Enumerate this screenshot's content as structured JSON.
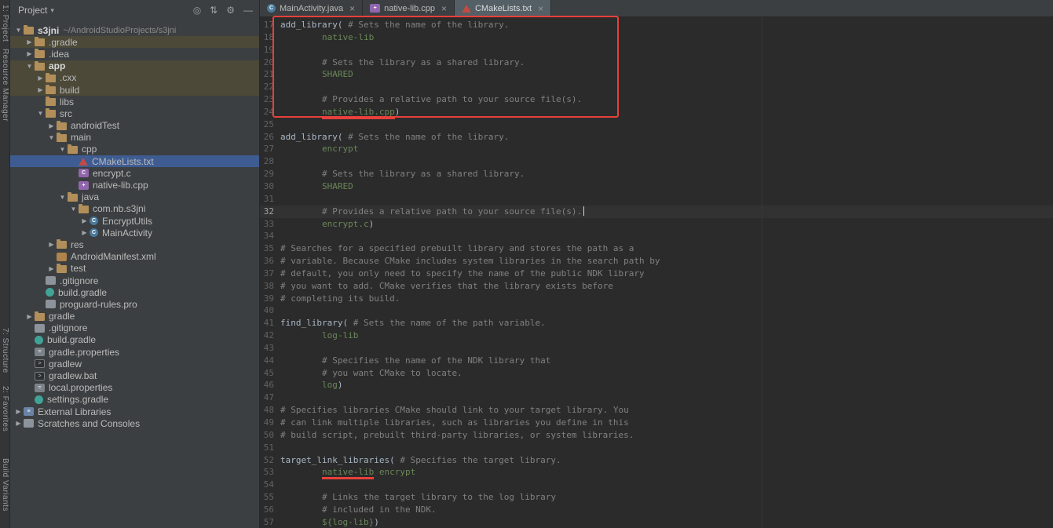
{
  "colors": {
    "selection_blue": "#3e5c92",
    "excluded_olive": "#4c4939",
    "annotation_red": "#e8403a",
    "code_plain": "#a9b7c6",
    "code_comment": "#808080",
    "code_argument": "#6a8759"
  },
  "left_strip": {
    "items": [
      {
        "label": "1: Project"
      },
      {
        "label": "Resource Manager"
      },
      {
        "label": "7: Structure"
      },
      {
        "label": "2: Favorites"
      },
      {
        "label": "Build Variants"
      }
    ]
  },
  "project_panel": {
    "header": {
      "title": "Project",
      "caret": "▾",
      "icons": [
        {
          "name": "locate-file-icon",
          "glyph": "◎"
        },
        {
          "name": "collapse-all-icon",
          "glyph": "⇅"
        },
        {
          "name": "settings-gear-icon",
          "glyph": "⚙"
        },
        {
          "name": "hide-panel-icon",
          "glyph": "―"
        }
      ]
    },
    "tree": [
      {
        "l": "s3jni",
        "s": "~/AndroidStudioProjects/s3jni",
        "v": 0,
        "i": "folder",
        "c": "d",
        "b": 1
      },
      {
        "l": ".gradle",
        "v": 1,
        "i": "folder",
        "c": "r",
        "tint": 1
      },
      {
        "l": ".idea",
        "v": 1,
        "i": "folder",
        "c": "r"
      },
      {
        "l": "app",
        "v": 1,
        "i": "folder",
        "c": "d",
        "tint": 1,
        "b": 1
      },
      {
        "l": ".cxx",
        "v": 2,
        "i": "folder",
        "c": "r",
        "tint": 1
      },
      {
        "l": "build",
        "v": 2,
        "i": "folder",
        "c": "r",
        "tint": 1
      },
      {
        "l": "libs",
        "v": 2,
        "i": "folder"
      },
      {
        "l": "src",
        "v": 2,
        "i": "folder",
        "c": "d"
      },
      {
        "l": "androidTest",
        "v": 3,
        "i": "folder",
        "c": "r"
      },
      {
        "l": "main",
        "v": 3,
        "i": "folder",
        "c": "d"
      },
      {
        "l": "cpp",
        "v": 4,
        "i": "folder",
        "c": "d"
      },
      {
        "l": "CMakeLists.txt",
        "v": 5,
        "i": "cmake",
        "sel": 1
      },
      {
        "l": "encrypt.c",
        "v": 5,
        "i": "c-file"
      },
      {
        "l": "native-lib.cpp",
        "v": 5,
        "i": "cpp-file"
      },
      {
        "l": "java",
        "v": 4,
        "i": "folder",
        "c": "d"
      },
      {
        "l": "com.nb.s3jni",
        "v": 5,
        "i": "package",
        "c": "d"
      },
      {
        "l": "EncryptUtils",
        "v": 6,
        "i": "class",
        "c": "r"
      },
      {
        "l": "MainActivity",
        "v": 6,
        "i": "class",
        "c": "r"
      },
      {
        "l": "res",
        "v": 3,
        "i": "folder",
        "c": "r"
      },
      {
        "l": "AndroidManifest.xml",
        "v": 3,
        "i": "xml-file"
      },
      {
        "l": "test",
        "v": 3,
        "i": "folder",
        "c": "r"
      },
      {
        "l": ".gitignore",
        "v": 2,
        "i": "gitignore"
      },
      {
        "l": "build.gradle",
        "v": 2,
        "i": "gradle"
      },
      {
        "l": "proguard-rules.pro",
        "v": 2,
        "i": "proguard"
      },
      {
        "l": "gradle",
        "v": 1,
        "i": "folder",
        "c": "r"
      },
      {
        "l": ".gitignore",
        "v": 1,
        "i": "gitignore"
      },
      {
        "l": "build.gradle",
        "v": 1,
        "i": "gradle"
      },
      {
        "l": "gradle.properties",
        "v": 1,
        "i": "properties"
      },
      {
        "l": "gradlew",
        "v": 1,
        "i": "shell"
      },
      {
        "l": "gradlew.bat",
        "v": 1,
        "i": "shell"
      },
      {
        "l": "local.properties",
        "v": 1,
        "i": "properties"
      },
      {
        "l": "settings.gradle",
        "v": 1,
        "i": "gradle"
      },
      {
        "l": "External Libraries",
        "v": 0,
        "i": "libraries",
        "c": "r"
      },
      {
        "l": "Scratches and Consoles",
        "v": 0,
        "i": "scratches",
        "c": "r"
      }
    ]
  },
  "editor": {
    "close_glyph": "×",
    "tabs": [
      {
        "label": "MainActivity.java",
        "icon": "class",
        "active": false
      },
      {
        "label": "native-lib.cpp",
        "icon": "cpp-file",
        "active": false
      },
      {
        "label": "CMakeLists.txt",
        "icon": "cmake",
        "active": true
      }
    ],
    "current_line": 32,
    "lines": [
      {
        "n": 17,
        "seg": [
          [
            "p",
            "add_library( "
          ],
          [
            "c",
            "# Sets the name of the library."
          ]
        ]
      },
      {
        "n": 18,
        "seg": [
          [
            "a",
            "        native-lib"
          ]
        ]
      },
      {
        "n": 19,
        "seg": []
      },
      {
        "n": 20,
        "seg": [
          [
            "c",
            "        # Sets the library as a shared library."
          ]
        ]
      },
      {
        "n": 21,
        "seg": [
          [
            "a",
            "        SHARED"
          ]
        ]
      },
      {
        "n": 22,
        "seg": []
      },
      {
        "n": 23,
        "seg": [
          [
            "c",
            "        # Provides a relative path to your source file(s)."
          ]
        ]
      },
      {
        "n": 24,
        "seg": [
          [
            "a",
            "        "
          ],
          [
            "a",
            "native-lib.cpp",
            "u"
          ],
          [
            "p",
            ")"
          ]
        ]
      },
      {
        "n": 25,
        "seg": []
      },
      {
        "n": 26,
        "seg": [
          [
            "p",
            "add_library( "
          ],
          [
            "c",
            "# Sets the name of the library."
          ]
        ]
      },
      {
        "n": 27,
        "seg": [
          [
            "a",
            "        encrypt"
          ]
        ]
      },
      {
        "n": 28,
        "seg": []
      },
      {
        "n": 29,
        "seg": [
          [
            "c",
            "        # Sets the library as a shared library."
          ]
        ]
      },
      {
        "n": 30,
        "seg": [
          [
            "a",
            "        SHARED"
          ]
        ]
      },
      {
        "n": 31,
        "seg": []
      },
      {
        "n": 32,
        "seg": [
          [
            "c",
            "        # Provides a relative path to your source file(s)."
          ],
          [
            "caret",
            ""
          ]
        ]
      },
      {
        "n": 33,
        "seg": [
          [
            "a",
            "        encrypt.c"
          ],
          [
            "p",
            ")"
          ]
        ]
      },
      {
        "n": 34,
        "seg": []
      },
      {
        "n": 35,
        "seg": [
          [
            "c",
            "# Searches for a specified prebuilt library and stores the path as a"
          ]
        ]
      },
      {
        "n": 36,
        "seg": [
          [
            "c",
            "# variable. Because CMake includes system libraries in the search path by"
          ]
        ]
      },
      {
        "n": 37,
        "seg": [
          [
            "c",
            "# default, you only need to specify the name of the public NDK library"
          ]
        ]
      },
      {
        "n": 38,
        "seg": [
          [
            "c",
            "# you want to add. CMake verifies that the library exists before"
          ]
        ]
      },
      {
        "n": 39,
        "seg": [
          [
            "c",
            "# completing its build."
          ]
        ]
      },
      {
        "n": 40,
        "seg": []
      },
      {
        "n": 41,
        "seg": [
          [
            "p",
            "find_library( "
          ],
          [
            "c",
            "# Sets the name of the path variable."
          ]
        ]
      },
      {
        "n": 42,
        "seg": [
          [
            "a",
            "        log-lib"
          ]
        ]
      },
      {
        "n": 43,
        "seg": []
      },
      {
        "n": 44,
        "seg": [
          [
            "c",
            "        # Specifies the name of the NDK library that"
          ]
        ]
      },
      {
        "n": 45,
        "seg": [
          [
            "c",
            "        # you want CMake to locate."
          ]
        ]
      },
      {
        "n": 46,
        "seg": [
          [
            "a",
            "        log"
          ],
          [
            "p",
            ")"
          ]
        ]
      },
      {
        "n": 47,
        "seg": []
      },
      {
        "n": 48,
        "seg": [
          [
            "c",
            "# Specifies libraries CMake should link to your target library. You"
          ]
        ]
      },
      {
        "n": 49,
        "seg": [
          [
            "c",
            "# can link multiple libraries, such as libraries you define in this"
          ]
        ]
      },
      {
        "n": 50,
        "seg": [
          [
            "c",
            "# build script, prebuilt third-party libraries, or system libraries."
          ]
        ]
      },
      {
        "n": 51,
        "seg": []
      },
      {
        "n": 52,
        "seg": [
          [
            "p",
            "target_link_libraries( "
          ],
          [
            "c",
            "# Specifies the target library."
          ]
        ]
      },
      {
        "n": 53,
        "seg": [
          [
            "a",
            "        "
          ],
          [
            "a",
            "native-lib",
            "u"
          ],
          [
            "a",
            " encrypt"
          ]
        ]
      },
      {
        "n": 54,
        "seg": []
      },
      {
        "n": 55,
        "seg": [
          [
            "c",
            "        # Links the target library to the log library"
          ]
        ]
      },
      {
        "n": 56,
        "seg": [
          [
            "c",
            "        # included in the NDK."
          ]
        ]
      },
      {
        "n": 57,
        "seg": [
          [
            "a",
            "        ${log-lib}"
          ],
          [
            "p",
            ")"
          ]
        ]
      }
    ],
    "annotations": {
      "red_box_lines": "17-24",
      "underlined_terms": [
        "native-lib.cpp",
        "native-lib"
      ]
    }
  }
}
